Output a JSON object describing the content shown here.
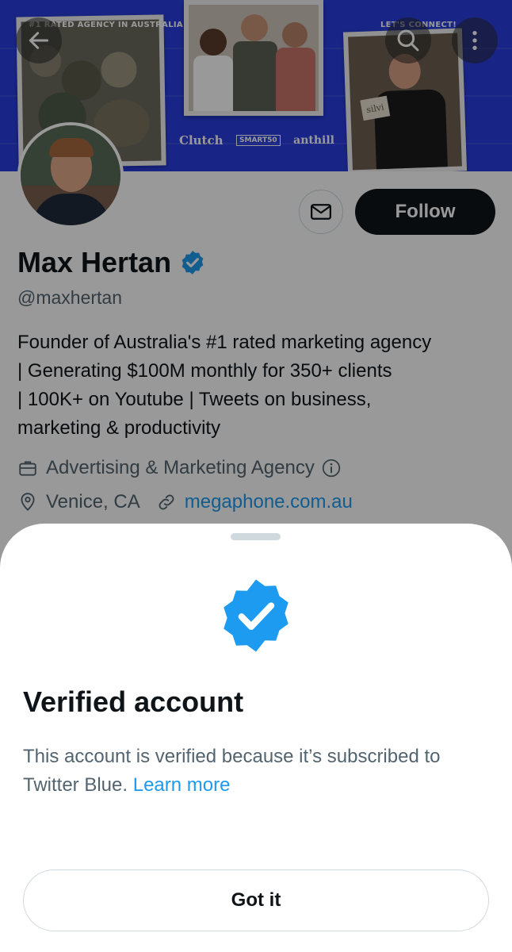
{
  "banner": {
    "left_caption": "#1 RATED AGENCY IN AUSTRALIA",
    "right_caption": "LET'S CONNECT!",
    "awards": {
      "clutch": "Clutch",
      "smart": "SMART50",
      "anthill": "anthill"
    },
    "sign_text": "silvi"
  },
  "profile": {
    "name": "Max Hertan",
    "handle": "@maxhertan",
    "follow_label": "Follow",
    "bio_lines": [
      "Founder of Australia's #1 rated marketing agency",
      "| Generating $100M monthly for 350+ clients",
      "| 100K+ on Youtube | Tweets on business,",
      "marketing & productivity"
    ],
    "category": "Advertising & Marketing Agency",
    "location": "Venice, CA",
    "website": "megaphone.com.au"
  },
  "sheet": {
    "title": "Verified account",
    "text": "This account is verified because it’s subscribed to Twitter Blue.",
    "link": "Learn more",
    "button_label": "Got it"
  },
  "colors": {
    "accent": "#1d9bf0",
    "banner": "#2a3fe0",
    "text_primary": "#0f1419",
    "text_secondary": "#536471"
  },
  "icons": [
    "back-arrow-icon",
    "search-icon",
    "more-vertical-icon",
    "mail-icon",
    "verified-badge-icon",
    "briefcase-icon",
    "info-icon",
    "location-pin-icon",
    "link-icon"
  ]
}
